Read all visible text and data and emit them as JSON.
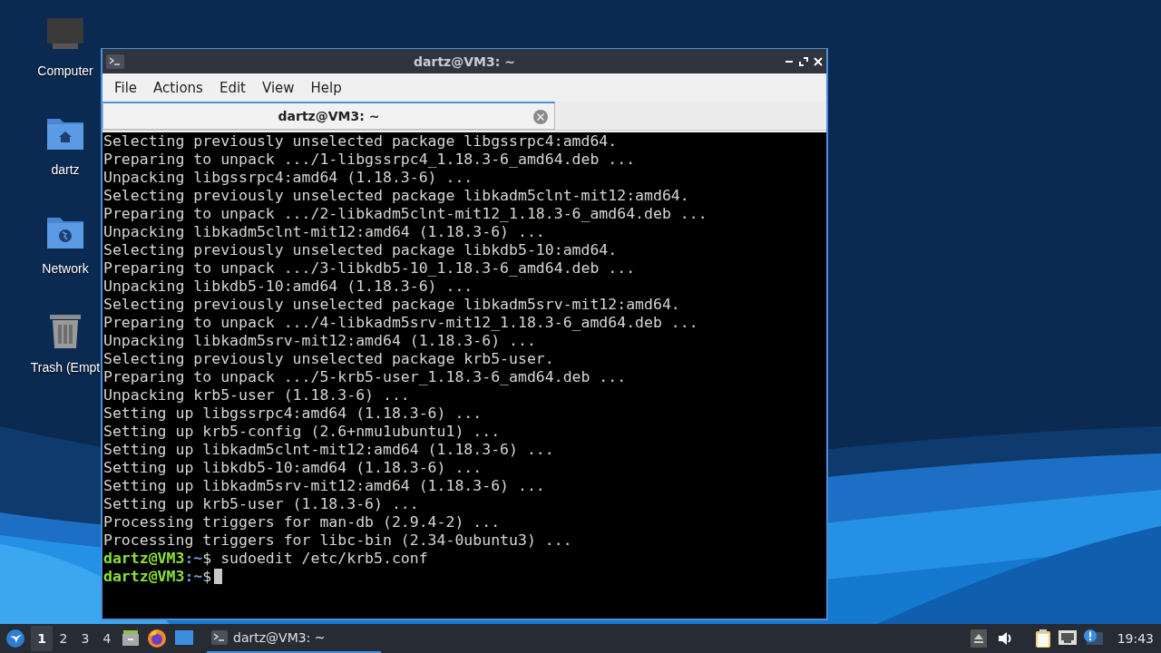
{
  "desktop_icons": [
    {
      "label": "Computer",
      "kind": "computer"
    },
    {
      "label": "dartz",
      "kind": "home"
    },
    {
      "label": "Network",
      "kind": "network"
    },
    {
      "label": "Trash (Empt",
      "kind": "trash"
    }
  ],
  "window": {
    "title": "dartz@VM3: ~",
    "menu": [
      "File",
      "Actions",
      "Edit",
      "View",
      "Help"
    ],
    "tabs": [
      {
        "label": "dartz@VM3: ~",
        "selected": true
      }
    ],
    "lines": [
      {
        "kind": "output",
        "text": "Selecting previously unselected package libgssrpc4:amd64."
      },
      {
        "kind": "output",
        "text": "Preparing to unpack .../1-libgssrpc4_1.18.3-6_amd64.deb ..."
      },
      {
        "kind": "output",
        "text": "Unpacking libgssrpc4:amd64 (1.18.3-6) ..."
      },
      {
        "kind": "output",
        "text": "Selecting previously unselected package libkadm5clnt-mit12:amd64."
      },
      {
        "kind": "output",
        "text": "Preparing to unpack .../2-libkadm5clnt-mit12_1.18.3-6_amd64.deb ..."
      },
      {
        "kind": "output",
        "text": "Unpacking libkadm5clnt-mit12:amd64 (1.18.3-6) ..."
      },
      {
        "kind": "output",
        "text": "Selecting previously unselected package libkdb5-10:amd64."
      },
      {
        "kind": "output",
        "text": "Preparing to unpack .../3-libkdb5-10_1.18.3-6_amd64.deb ..."
      },
      {
        "kind": "output",
        "text": "Unpacking libkdb5-10:amd64 (1.18.3-6) ..."
      },
      {
        "kind": "output",
        "text": "Selecting previously unselected package libkadm5srv-mit12:amd64."
      },
      {
        "kind": "output",
        "text": "Preparing to unpack .../4-libkadm5srv-mit12_1.18.3-6_amd64.deb ..."
      },
      {
        "kind": "output",
        "text": "Unpacking libkadm5srv-mit12:amd64 (1.18.3-6) ..."
      },
      {
        "kind": "output",
        "text": "Selecting previously unselected package krb5-user."
      },
      {
        "kind": "output",
        "text": "Preparing to unpack .../5-krb5-user_1.18.3-6_amd64.deb ..."
      },
      {
        "kind": "output",
        "text": "Unpacking krb5-user (1.18.3-6) ..."
      },
      {
        "kind": "output",
        "text": "Setting up libgssrpc4:amd64 (1.18.3-6) ..."
      },
      {
        "kind": "output",
        "text": "Setting up krb5-config (2.6+nmu1ubuntu1) ..."
      },
      {
        "kind": "output",
        "text": "Setting up libkadm5clnt-mit12:amd64 (1.18.3-6) ..."
      },
      {
        "kind": "output",
        "text": "Setting up libkdb5-10:amd64 (1.18.3-6) ..."
      },
      {
        "kind": "output",
        "text": "Setting up libkadm5srv-mit12:amd64 (1.18.3-6) ..."
      },
      {
        "kind": "output",
        "text": "Setting up krb5-user (1.18.3-6) ..."
      },
      {
        "kind": "output",
        "text": "Processing triggers for man-db (2.9.4-2) ..."
      },
      {
        "kind": "output",
        "text": "Processing triggers for libc-bin (2.34-0ubuntu3) ..."
      },
      {
        "kind": "prompt",
        "user": "dartz@VM3",
        "path": ":~",
        "symbol": "$",
        "command": "sudoedit /etc/krb5.conf",
        "cursor": false
      },
      {
        "kind": "prompt",
        "user": "dartz@VM3",
        "path": ":~",
        "symbol": "$",
        "cursor": true
      }
    ]
  },
  "taskbar": {
    "workspaces": [
      {
        "label": "1",
        "selected": true
      },
      {
        "label": "2",
        "selected": false
      },
      {
        "label": "3",
        "selected": false
      },
      {
        "label": "4",
        "selected": false
      }
    ],
    "tasks": [
      {
        "label": "dartz@VM3: ~",
        "selected": true
      }
    ],
    "clock": "19:43"
  }
}
